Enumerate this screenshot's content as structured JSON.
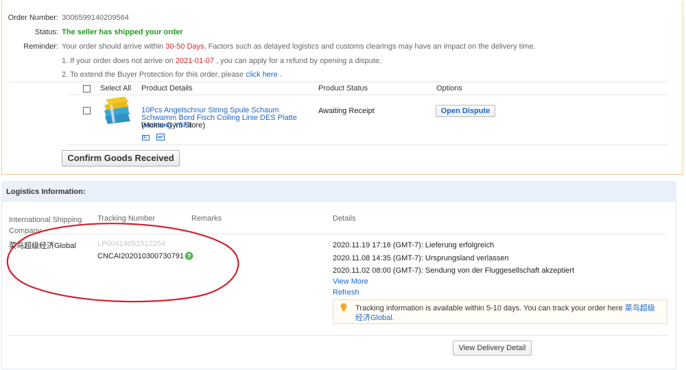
{
  "order": {
    "number_label": "Order Number:",
    "number": "3006599140209564",
    "status_label": "Status:",
    "status": "The seller has shipped your order",
    "reminder_label": "Reminder:",
    "reminder_pre": "Your order should arrive within",
    "reminder_days": "30-50 Days",
    "reminder_post": ", Factors such as delayed logistics and customs clearings may have an impact on the delivery time.",
    "note1_pre": "1. If your order does not arrive on",
    "note1_date": "2021-01-07",
    "note1_post": ", you can apply for a refund by opening a dispute.",
    "note2_pre": "2. To extend the Buyer Protection for this order, please",
    "note2_link": "click here",
    "note2_post": "."
  },
  "products": {
    "headers": {
      "select_all": "Select All",
      "details": "Product Details",
      "status": "Product Status",
      "options": "Options"
    },
    "item": {
      "title": "10Pcs Angelschnur String Spule Schaum Schwamm Bord Fisch Coiling Linie DES Platte Wicklung Y5F8",
      "store": "(Home-Gym Store)",
      "status": "Awaiting Receipt",
      "dispute_button": "Open Dispute"
    },
    "confirm_button": "Confirm Goods Received"
  },
  "logistics": {
    "title": "Logistics Information:",
    "headers": {
      "company": "International Shipping Company",
      "tracking": "Tracking Number",
      "remarks": "Remarks",
      "details": "Details"
    },
    "company": "菜鸟超级经济Global",
    "tracking_old": "LP00414051512254",
    "tracking_current": "CNCAI202010300730791 7",
    "events": [
      "2020.11.19 17:16 (GMT-7): Lieferung erfolgreich",
      "2020.11.08 14:35 (GMT-7): Ursprungsland verlassen",
      "2020.11.02 08:00 (GMT-7): Sendung von der Fluggesellschaft akzeptiert"
    ],
    "view_more": "View More",
    "refresh": "Refresh",
    "notice_text": "Tracking information is available within 5-10 days. You can track your order here",
    "notice_link": "菜鸟超级经济Global.",
    "delivery_button": "View Delivery Detail"
  },
  "colors": {
    "accent_link": "#1a66c9",
    "success": "#1f9a1f",
    "alert": "#e02020",
    "annotation": "#d0202a"
  }
}
